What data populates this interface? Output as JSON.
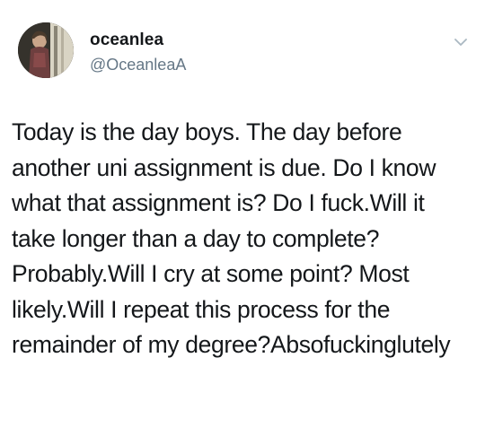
{
  "tweet": {
    "author": {
      "display_name": "oceanlea",
      "handle": "@OceanleaA",
      "avatar_icon": "profile-photo"
    },
    "menu_icon": "chevron-down-icon",
    "text": "Today is the day boys. The day before another uni assignment is due. Do I know what that assignment is? Do I fuck.Will it take longer than a day to complete? Probably.Will I cry at some point? Most likely.Will I repeat this process for the remainder of my degree?Absofuckinglutely"
  },
  "colors": {
    "text": "#14171a",
    "secondary": "#657786",
    "background": "#ffffff"
  }
}
